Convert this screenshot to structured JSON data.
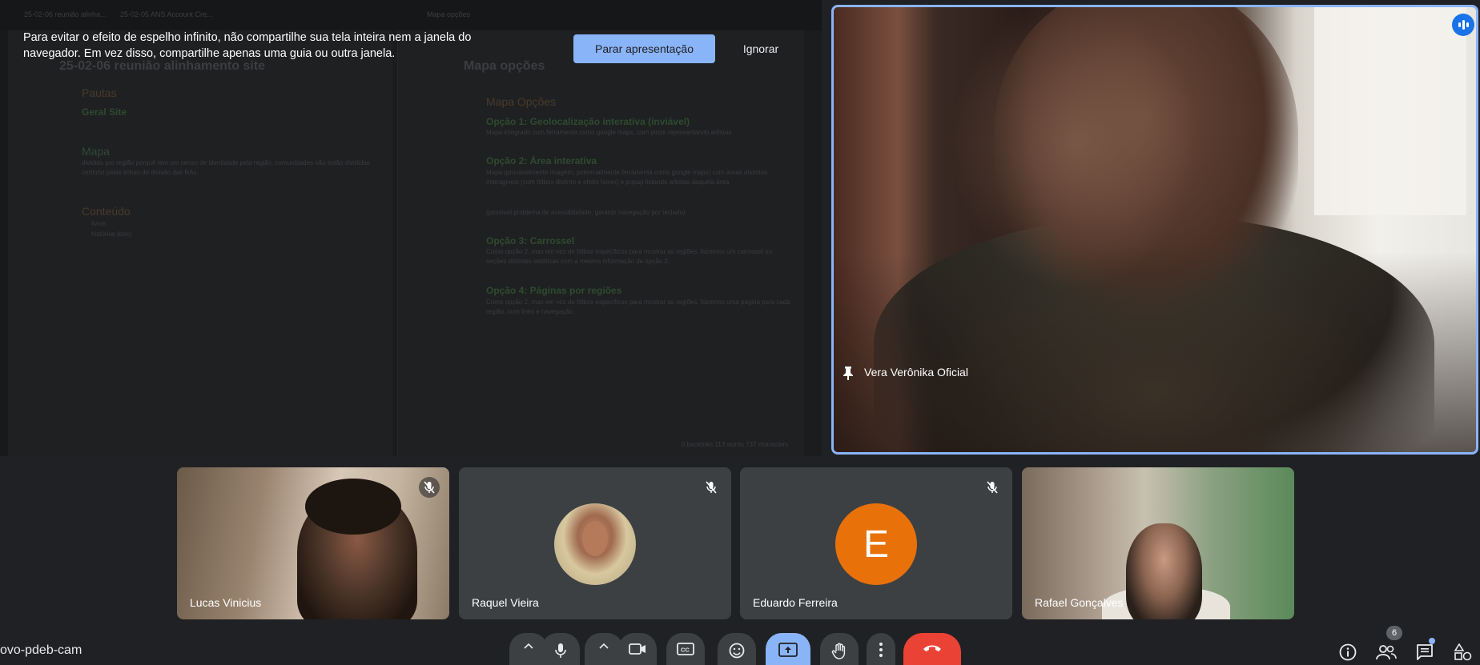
{
  "shared_screen": {
    "tabs": [
      "25-02-06 reunião alinha...",
      "25-02-05 ANS Account Cre...",
      "Mapa opções"
    ],
    "left_note": {
      "title": "25-02-06 reunião alinhamento site",
      "sections": [
        {
          "heading": "Pautas",
          "sub": "Geral Site"
        },
        {
          "heading": "Mapa",
          "body": "dividido por região porquê tem um senso de identidade pela região, comunidades não estão divididas certinho pelas linhas de divisão das RAs."
        },
        {
          "heading": "Conteúdo",
          "items": [
            "livros",
            "histórias (doc)"
          ]
        }
      ]
    },
    "right_note": {
      "title": "Mapa opções",
      "heading": "Mapa Opções",
      "options": [
        {
          "title": "Opção 1: Geolocalização interativa (inviável)",
          "body": "Mapa integrado com ferramenta como google maps, com pinos representando artistas"
        },
        {
          "title": "Opção 2: Área interativa",
          "body": "Mapa (provavelmente imagem, potencialmente ferramenta como google maps) com áreas distintas interagíveis (com hitbox distinto e efeito hover) e popup listando artistas daquela área",
          "note": "(possível problema de acessibilidade, garantir navegação por teclado)"
        },
        {
          "title": "Opção 3: Carrossel",
          "body": "Como opção 2, mas em vez de hitbox específicos para mostrar as regiões, fazemos um carrossel ou seções distintas estáticas com a mesma informação da opção 2."
        },
        {
          "title": "Opção 4: Páginas por regiões",
          "body": "Como opção 2, mas em vez de hitbox específicos para mostrar as regiões, fazemos uma página para cada região, com links e navegação."
        }
      ],
      "status": "0 backlinks   113 words   737 characters"
    }
  },
  "banner": {
    "message": "Para evitar o efeito de espelho infinito, não compartilhe sua tela inteira nem a janela do navegador. Em vez disso, compartilhe apenas uma guia ou outra janela.",
    "stop_label": "Parar apresentação",
    "ignore_label": "Ignorar"
  },
  "featured": {
    "name": "Vera Verônika Oficial",
    "pin_icon": "pin-icon",
    "speaking_icon": "audio-level-icon"
  },
  "participants": [
    {
      "name": "Lucas Vinicius",
      "muted": true,
      "type": "video"
    },
    {
      "name": "Raquel Vieira",
      "muted": true,
      "type": "photo"
    },
    {
      "name": "Eduardo Ferreira",
      "muted": true,
      "type": "initial",
      "initial": "E",
      "color": "#e8710a"
    },
    {
      "name": "Rafael Gonçalves",
      "muted": false,
      "type": "video"
    }
  ],
  "meeting_code": "ovo-pdeb-cam",
  "people_count": "6",
  "colors": {
    "accent": "#8ab4f8",
    "end_call": "#ea4335",
    "speaking": "#1a73e8",
    "background": "#202124",
    "tile": "#3c4043"
  }
}
